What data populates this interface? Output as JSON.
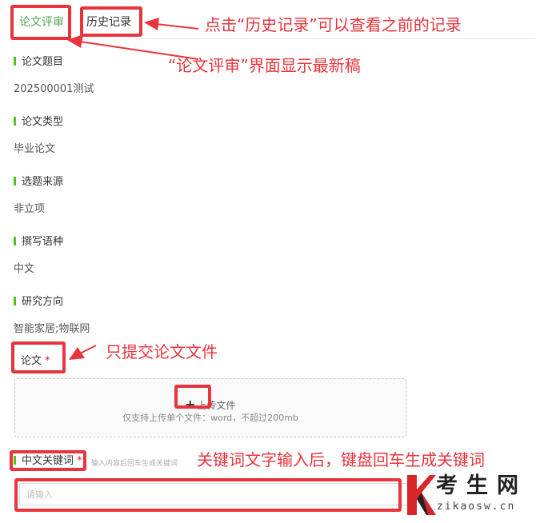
{
  "tabs": [
    {
      "label": "论文评审",
      "active": true
    },
    {
      "label": "历史记录",
      "active": false
    }
  ],
  "sections": [
    {
      "label": "论文题目",
      "value": "202500001测试"
    },
    {
      "label": "论文类型",
      "value": "毕业论文"
    },
    {
      "label": "选题来源",
      "value": "非立项"
    },
    {
      "label": "撰写语种",
      "value": "中文"
    },
    {
      "label": "研究方向",
      "value": "智能家居;物联网"
    }
  ],
  "paper": {
    "label": "论文",
    "required_mark": "*",
    "upload_label": "上传文件",
    "upload_hint": "仅支持上传单个文件：word，不超过200mb"
  },
  "keywords": {
    "label": "中文关键词",
    "required_mark": "*",
    "hint": "输入内容后回车生成关键词",
    "placeholder": "请输入"
  },
  "annotations": {
    "history": "点击“历史记录”可以查看之前的记录",
    "review": "“论文评审”界面显示最新稿",
    "upload": "只提交论文文件",
    "keywords": "关键词文字输入后，键盘回车生成关键词"
  },
  "watermark": {
    "name": "考生网",
    "url": "zikaosw.cn"
  },
  "colors": {
    "accent_green": "#52a352",
    "annotation_red": "#e8343c",
    "watermark_k": "#d9252a"
  }
}
